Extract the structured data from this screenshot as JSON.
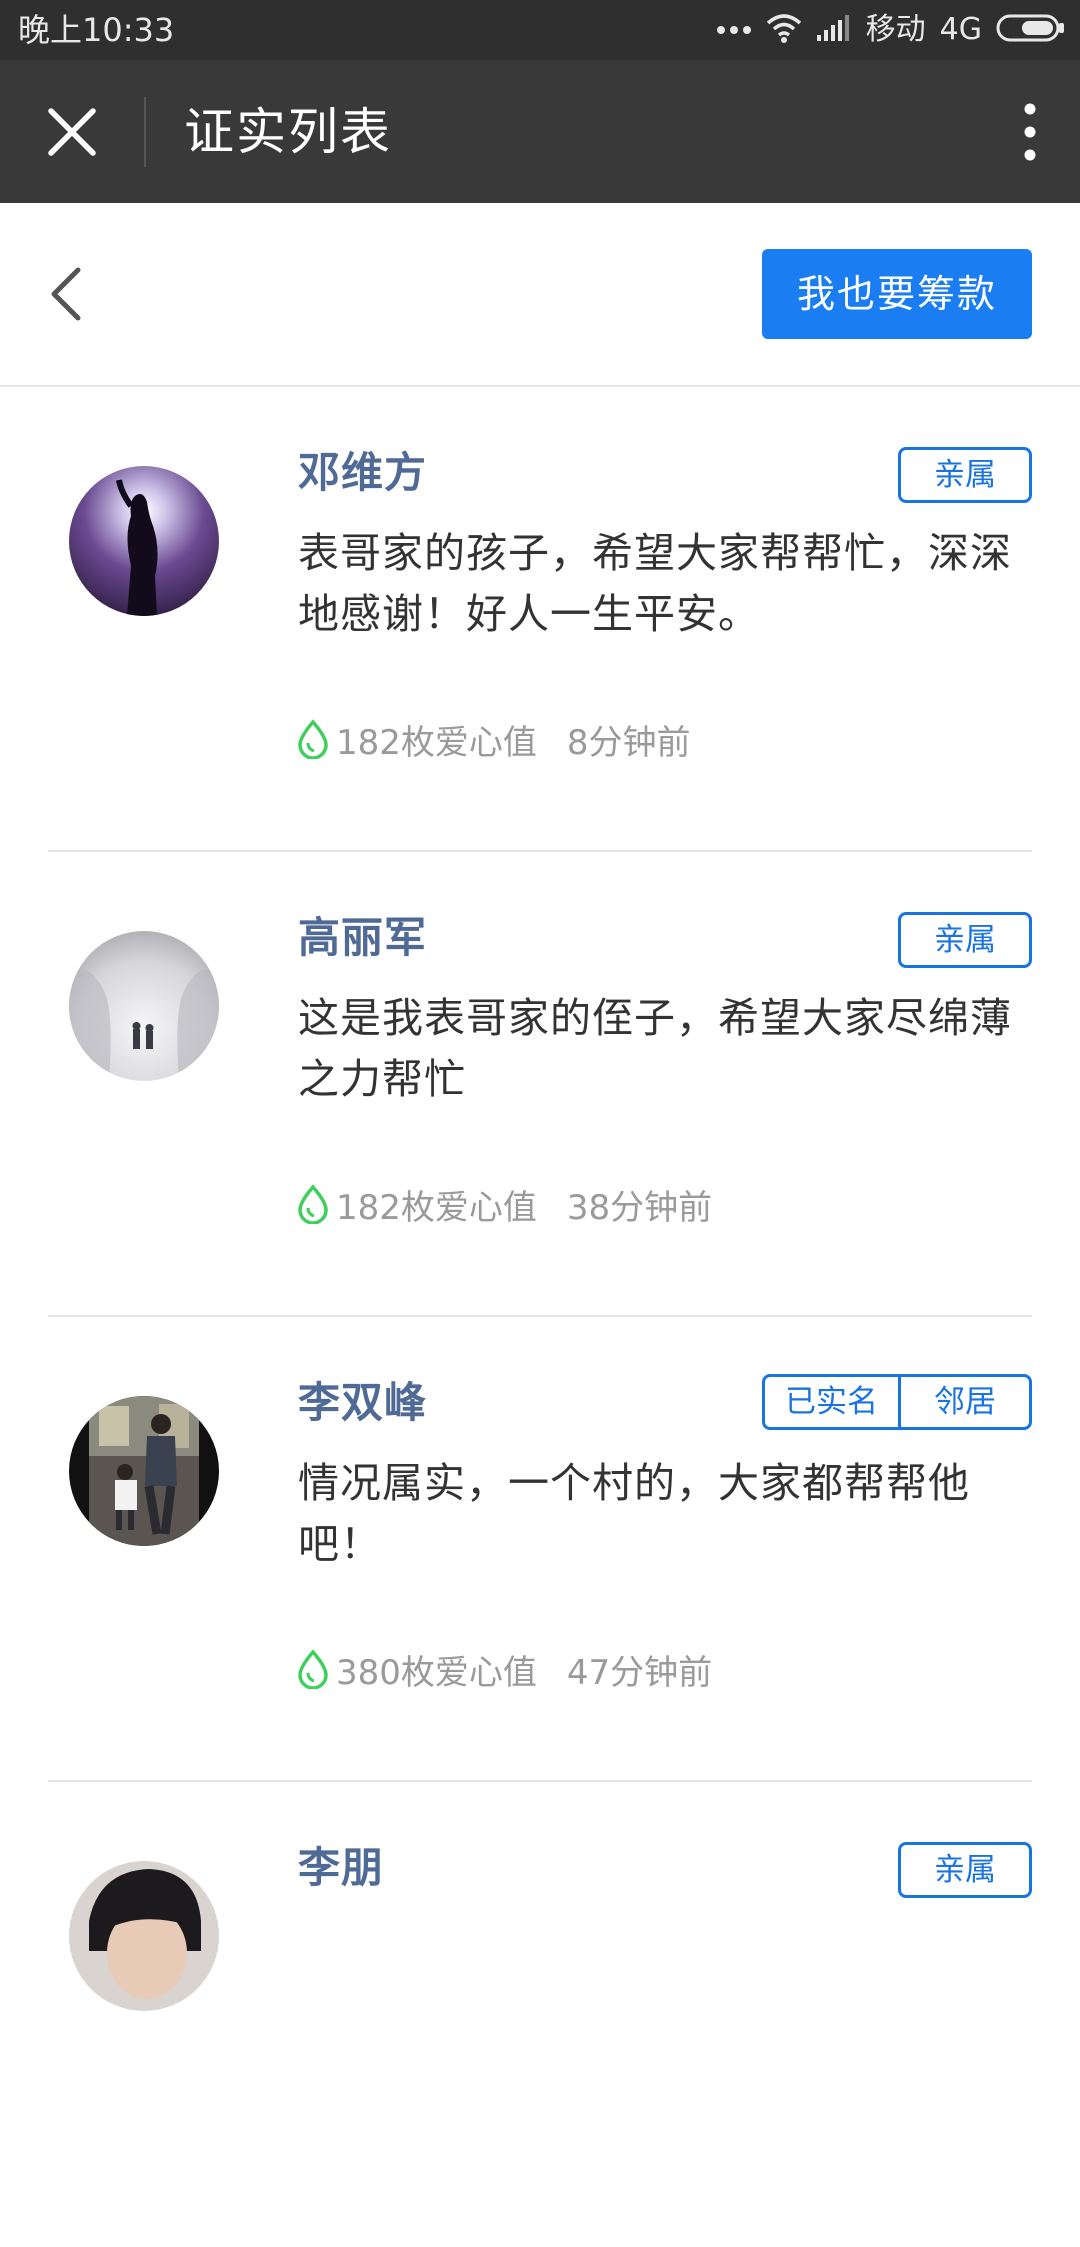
{
  "status_bar": {
    "time": "晚上10:33",
    "carrier": "移动",
    "network": "4G",
    "icons": [
      "dots-icon",
      "wifi-icon",
      "signal-icon",
      "battery-icon"
    ]
  },
  "title_bar": {
    "title": "证实列表",
    "close_icon": "close-icon",
    "more_icon": "more-vertical-icon"
  },
  "sub_header": {
    "back_icon": "chevron-left-icon",
    "fund_button_label": "我也要筹款",
    "button_color": "#1a7ef2"
  },
  "comments": [
    {
      "name": "邓维方",
      "tags": [
        "亲属"
      ],
      "text": "表哥家的孩子，希望大家帮帮忙，深深地感谢！好人一生平安。",
      "love_value": "182枚爱心值",
      "time_ago": "8分钟前"
    },
    {
      "name": "高丽军",
      "tags": [
        "亲属"
      ],
      "text": "这是我表哥家的侄子，希望大家尽绵薄之力帮忙",
      "love_value": "182枚爱心值",
      "time_ago": "38分钟前"
    },
    {
      "name": "李双峰",
      "tags": [
        "已实名",
        "邻居"
      ],
      "text": "情况属实，一个村的，大家都帮帮他吧！",
      "love_value": "380枚爱心值",
      "time_ago": "47分钟前"
    },
    {
      "name": "李朋",
      "tags": [
        "亲属"
      ],
      "text": "",
      "love_value": "",
      "time_ago": ""
    }
  ],
  "colors": {
    "name": "#506a96",
    "tag": "#1a74e0",
    "love_icon": "#3ecf5c",
    "meta_text": "#9a9a9a"
  }
}
